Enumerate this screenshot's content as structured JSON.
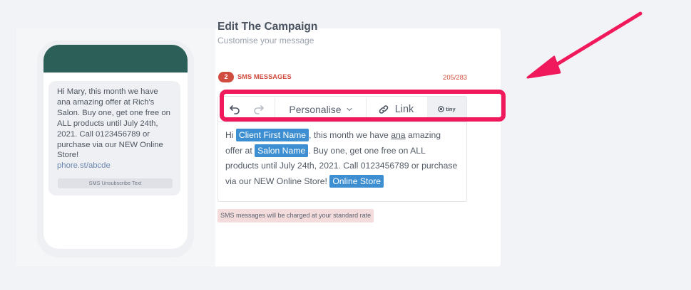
{
  "preview": {
    "message": "Hi Mary, this month we have ana amazing offer at Rich's Salon. Buy one, get one free on ALL products until July 24th, 2021. Call 0123456789 or purchase via our NEW Online Store!",
    "link": "phore.st/abcde",
    "unsubscribe": "SMS Unsubscribe Text"
  },
  "header": {
    "title": "Edit The Campaign",
    "subtitle": "Customise your message"
  },
  "counter": {
    "count": "2",
    "label": "SMS MESSAGES",
    "ratio": "205/283"
  },
  "toolbar": {
    "personalise_label": "Personalise",
    "link_label": "Link",
    "brand": "tiny"
  },
  "editor": {
    "t1": "Hi ",
    "token_client": "Client First Name",
    "t2": ", this month we have ",
    "underlined_word": "ana",
    "t3": " amazing offer at ",
    "token_salon": "Salon Name",
    "t4": ". Buy one, get one free on ALL products until July 24th, 2021. Call 0123456789 or purchase via our NEW Online Store! ",
    "token_store": "Online Store"
  },
  "notice": "SMS messages will be charged at your standard rate",
  "colors": {
    "phone_header": "#2c5f57",
    "token": "#3d8fd1",
    "alert": "#cf4c3e",
    "highlight": "#f0195c"
  },
  "icons": [
    "undo-icon",
    "redo-icon",
    "chevron-down-icon",
    "link-icon",
    "tiny-logo-icon",
    "arrow-annotation"
  ]
}
